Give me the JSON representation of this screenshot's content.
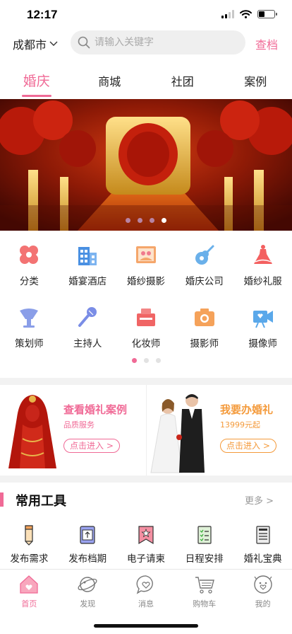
{
  "status": {
    "time": "12:17",
    "battery_level": 0.4
  },
  "header": {
    "city": "成都市",
    "search_placeholder": "请输入关键字",
    "search_button": "查档"
  },
  "tabs": [
    {
      "label": "婚庆",
      "active": true
    },
    {
      "label": "商城",
      "active": false
    },
    {
      "label": "社团",
      "active": false
    },
    {
      "label": "案例",
      "active": false
    }
  ],
  "banner": {
    "slide_count": 4,
    "active_slide": 4
  },
  "categories": [
    {
      "label": "分类",
      "icon": "clover-icon"
    },
    {
      "label": "婚宴酒店",
      "icon": "hotel-icon"
    },
    {
      "label": "婚纱摄影",
      "icon": "photo-icon"
    },
    {
      "label": "婚庆公司",
      "icon": "guitar-icon"
    },
    {
      "label": "婚纱礼服",
      "icon": "dress-icon"
    },
    {
      "label": "策划师",
      "icon": "planner-icon"
    },
    {
      "label": "主持人",
      "icon": "microphone-icon"
    },
    {
      "label": "化妆师",
      "icon": "makeup-icon"
    },
    {
      "label": "摄影师",
      "icon": "camera-icon"
    },
    {
      "label": "摄像师",
      "icon": "video-camera-icon"
    }
  ],
  "category_pages": {
    "count": 3,
    "active": 1
  },
  "promos": [
    {
      "title": "查看婚礼案例",
      "subtitle": "品质服务",
      "button": "点击进入 >"
    },
    {
      "title": "我要办婚礼",
      "subtitle": "13999元起",
      "button": "点击进入 >"
    }
  ],
  "tools": {
    "title": "常用工具",
    "more": "更多 >",
    "items": [
      {
        "label": "发布需求",
        "icon": "pencil-icon"
      },
      {
        "label": "发布档期",
        "icon": "upload-icon"
      },
      {
        "label": "电子请柬",
        "icon": "invitation-icon"
      },
      {
        "label": "日程安排",
        "icon": "checklist-icon"
      },
      {
        "label": "婚礼宝典",
        "icon": "book-icon"
      }
    ]
  },
  "tabbar": [
    {
      "label": "首页",
      "icon": "home-icon",
      "active": true
    },
    {
      "label": "发现",
      "icon": "planet-icon",
      "active": false
    },
    {
      "label": "消息",
      "icon": "message-icon",
      "active": false
    },
    {
      "label": "购物车",
      "icon": "cart-icon",
      "active": false
    },
    {
      "label": "我的",
      "icon": "profile-icon",
      "active": false
    }
  ],
  "colors": {
    "accent": "#f06a96",
    "orange": "#f49a3b"
  }
}
